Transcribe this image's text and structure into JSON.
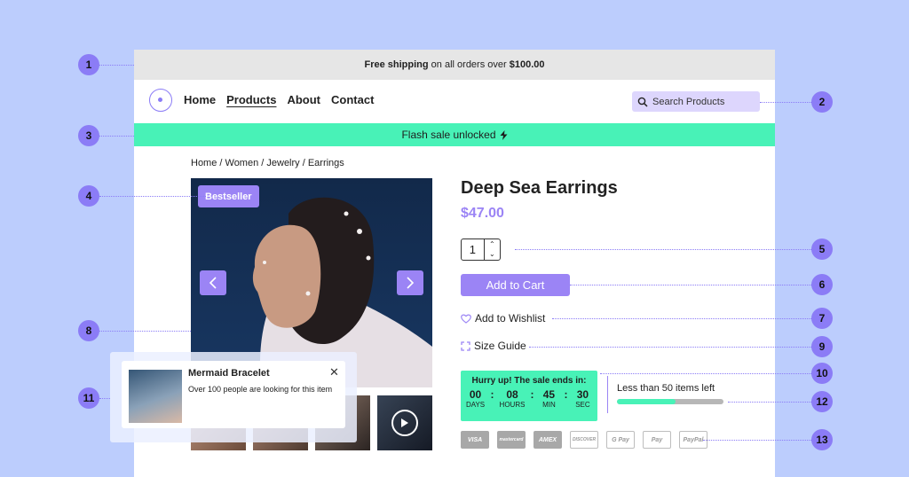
{
  "topbar": {
    "pre": "Free shipping",
    "mid": " on all orders over ",
    "amount": "$100.00"
  },
  "nav": {
    "items": [
      "Home",
      "Products",
      "About",
      "Contact"
    ],
    "active": "Products"
  },
  "search": {
    "placeholder": "Search Products"
  },
  "flash": {
    "text": "Flash sale unlocked"
  },
  "breadcrumb": "Home / Women / Jewelry / Earrings",
  "badge": "Bestseller",
  "product": {
    "title": "Deep Sea Earrings",
    "price": "$47.00",
    "quantity": "1"
  },
  "actions": {
    "add_to_cart": "Add to Cart",
    "wishlist": "Add to Wishlist",
    "size_guide": "Size Guide"
  },
  "sale": {
    "heading": "Hurry up! The sale ends in:",
    "days": "00",
    "days_label": "DAYS",
    "hours": "08",
    "hours_label": "HOURS",
    "min": "45",
    "min_label": "MIN",
    "sec": "30",
    "sec_label": "SEC"
  },
  "stock": {
    "text": "Less than 50 items left",
    "level": 0.55
  },
  "payments": [
    "VISA",
    "mastercard",
    "AMEX",
    "DISCOVER",
    "G Pay",
    "Pay",
    "PayPal"
  ],
  "popup": {
    "title": "Mermaid Bracelet",
    "subtitle": "Over 100 people are looking for this item"
  },
  "callouts": [
    "1",
    "2",
    "3",
    "4",
    "5",
    "6",
    "7",
    "8",
    "9",
    "10",
    "11",
    "12",
    "13"
  ],
  "colors": {
    "accent": "#9b84f5",
    "flash": "#48f2b7",
    "background": "#bccdfd"
  },
  "icons": [
    "logo-icon",
    "search-icon",
    "bolt-icon",
    "chevron-left-icon",
    "chevron-right-icon",
    "play-icon",
    "heart-icon",
    "size-guide-icon",
    "close-icon"
  ]
}
